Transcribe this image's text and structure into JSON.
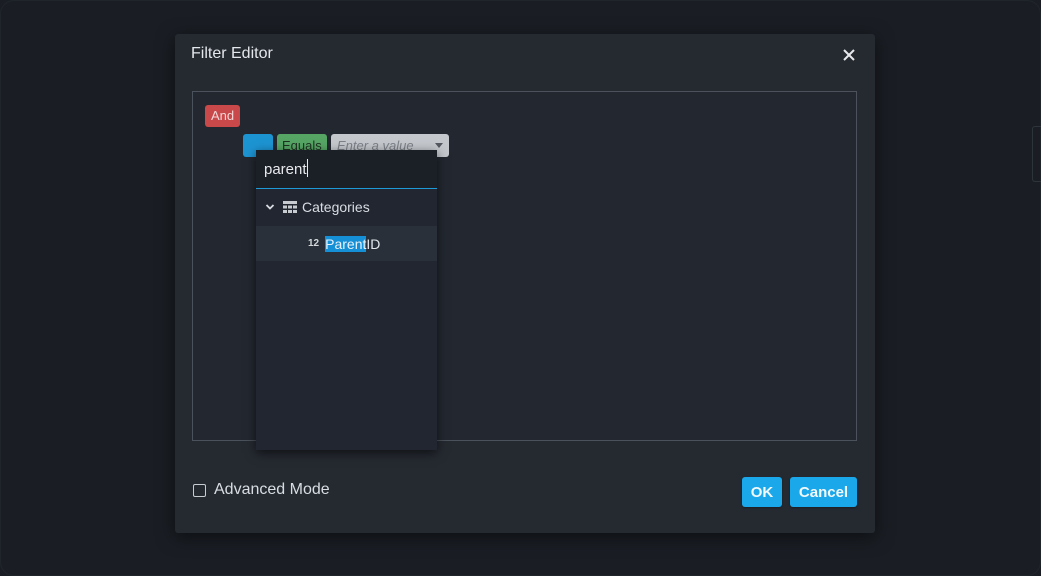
{
  "dialog": {
    "title": "Filter Editor"
  },
  "filter": {
    "group_operator": "And",
    "condition": {
      "field": "",
      "operator": "Equals",
      "value_placeholder": "Enter a value"
    }
  },
  "field_dropdown": {
    "search_value": "parent",
    "tree": {
      "category_label": "Categories",
      "item": {
        "type_label": "12",
        "match": "Parent",
        "rest": "ID"
      }
    }
  },
  "footer": {
    "advanced_mode_label": "Advanced Mode",
    "advanced_mode_checked": false,
    "ok_label": "OK",
    "cancel_label": "Cancel"
  },
  "colors": {
    "group_operator": "#c9484a",
    "field": "#1d94d2",
    "operator": "#56a565",
    "accent": "#1ba8ea"
  },
  "icons": [
    "close-icon",
    "chevron-down-icon",
    "grid-table-icon",
    "caret-down-icon"
  ]
}
